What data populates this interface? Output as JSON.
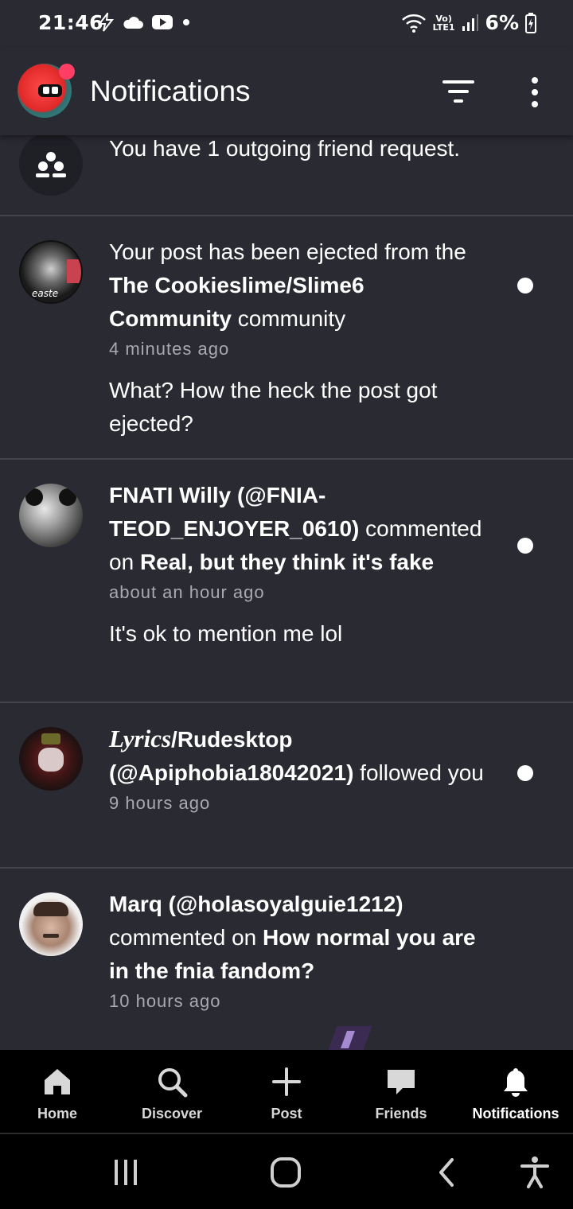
{
  "status_bar": {
    "time": "21:46",
    "network_top": "Vo)",
    "network_bottom": "LTE1",
    "battery": "6%"
  },
  "header": {
    "title": "Notifications"
  },
  "notifications": [
    {
      "type": "friend_request",
      "text": "You have 1 outgoing friend request.",
      "icon": "group-icon"
    },
    {
      "type": "ejected",
      "text_pre": "Your post has been ejected from the ",
      "community": "The Cookieslime/Slime6 Community",
      "text_post": " community",
      "time": "4 minutes ago",
      "comment": "What? How the heck the post got ejected?",
      "avatar_label": "easte",
      "unread": true
    },
    {
      "type": "comment",
      "user": "FNATI Willy (@FNIA-TEOD_ENJOYER_0610)",
      "action": " commented on ",
      "post": "Real, but they think it's fake",
      "time": "about an hour ago",
      "comment": "It's ok to mention me lol",
      "unread": true
    },
    {
      "type": "follow",
      "user_italic": "Lyrics",
      "user_rest": "/Rudesktop (@Apiphobia18042021)",
      "action": " followed you",
      "time": "9 hours ago",
      "unread": true
    },
    {
      "type": "comment",
      "user": "Marq (@holasoyalguie1212)",
      "action": " commented on ",
      "post": "How normal you are in the fnia fandom?",
      "time": "10 hours ago",
      "unread": false
    }
  ],
  "bottom_nav": [
    {
      "label": "Home",
      "icon": "home-icon"
    },
    {
      "label": "Discover",
      "icon": "search-icon"
    },
    {
      "label": "Post",
      "icon": "plus-icon"
    },
    {
      "label": "Friends",
      "icon": "chat-bubble-icon"
    },
    {
      "label": "Notifications",
      "icon": "bell-icon",
      "active": true
    }
  ],
  "colors": {
    "background": "#2a2a33",
    "divider": "#44444d",
    "muted_text": "#a9a9b2",
    "nav_bg": "#000000"
  }
}
